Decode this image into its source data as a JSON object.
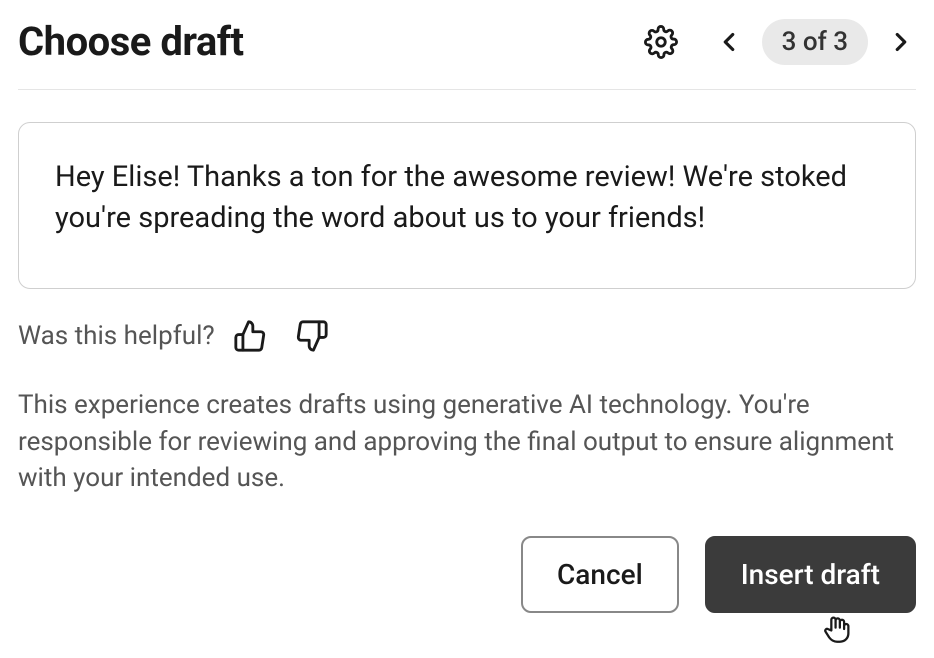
{
  "header": {
    "title": "Choose draft",
    "page_indicator": "3 of 3"
  },
  "draft": {
    "text": "Hey Elise! Thanks a ton for the awesome review! We're stoked you're spreading the word about us to your friends!"
  },
  "feedback": {
    "prompt": "Was this helpful?"
  },
  "disclaimer": {
    "text": "This experience creates drafts using generative AI technology. You're responsible for reviewing and approving the final output to ensure alignment with your intended use."
  },
  "actions": {
    "cancel_label": "Cancel",
    "insert_label": "Insert draft"
  }
}
